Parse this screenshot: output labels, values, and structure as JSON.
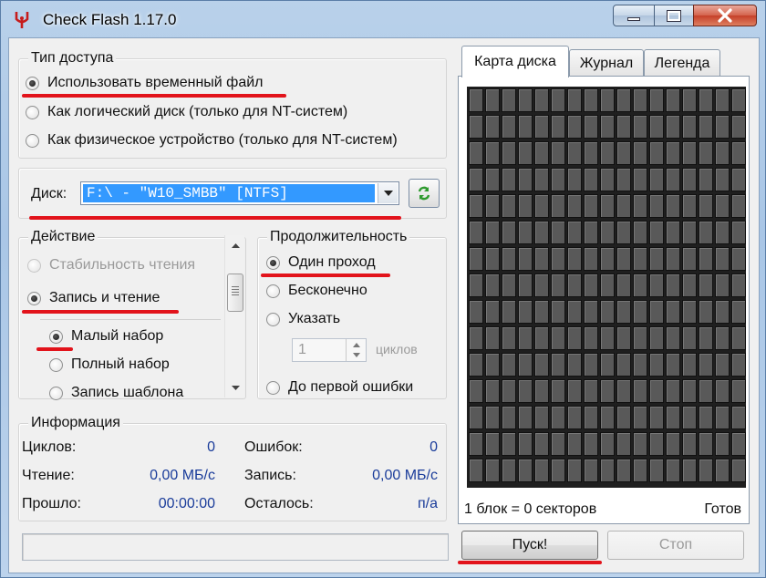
{
  "window": {
    "title": "Check Flash 1.17.0"
  },
  "access_type": {
    "title": "Тип доступа",
    "options": [
      {
        "label": "Использовать временный файл",
        "checked": true
      },
      {
        "label": "Как логический диск (только для NT-систем)",
        "checked": false
      },
      {
        "label": "Как физическое устройство (только для NT-систем)",
        "checked": false
      }
    ]
  },
  "drive": {
    "label": "Диск:",
    "value": "F:\\ - \"W10_SMBB\" [NTFS]"
  },
  "action": {
    "title": "Действие",
    "options": [
      {
        "label": "Стабильность чтения",
        "checked": false,
        "disabled": true
      },
      {
        "label": "Запись и чтение",
        "checked": true,
        "disabled": false
      },
      {
        "label": "Малый набор",
        "checked": true,
        "disabled": false
      },
      {
        "label": "Полный набор",
        "checked": false,
        "disabled": false
      },
      {
        "label": "Запись шаблона",
        "checked": false,
        "disabled": false
      }
    ]
  },
  "duration": {
    "title": "Продолжительность",
    "options": [
      {
        "label": "Один проход",
        "checked": true
      },
      {
        "label": "Бесконечно",
        "checked": false
      },
      {
        "label": "Указать",
        "checked": false
      },
      {
        "label": "До первой ошибки",
        "checked": false
      }
    ],
    "cycles_value": "1",
    "cycles_unit": "циклов"
  },
  "info": {
    "title": "Информация",
    "cycles_label": "Циклов:",
    "cycles_value": "0",
    "errors_label": "Ошибок:",
    "errors_value": "0",
    "read_label": "Чтение:",
    "read_value": "0,00 МБ/с",
    "write_label": "Запись:",
    "write_value": "0,00 МБ/с",
    "elapsed_label": "Прошло:",
    "elapsed_value": "00:00:00",
    "remaining_label": "Осталось:",
    "remaining_value": "п/а"
  },
  "tabs": [
    "Карта диска",
    "Журнал",
    "Легенда"
  ],
  "map": {
    "columns": 17,
    "rows": 15,
    "block_info": "1 блок = 0 секторов",
    "status": "Готов"
  },
  "buttons": {
    "start": "Пуск!",
    "stop": "Стоп"
  },
  "colors": {
    "highlight_red": "#e2131b",
    "selection_blue": "#3399ff",
    "map_cell": "#595959",
    "disabled_text": "#9a9a9a"
  }
}
